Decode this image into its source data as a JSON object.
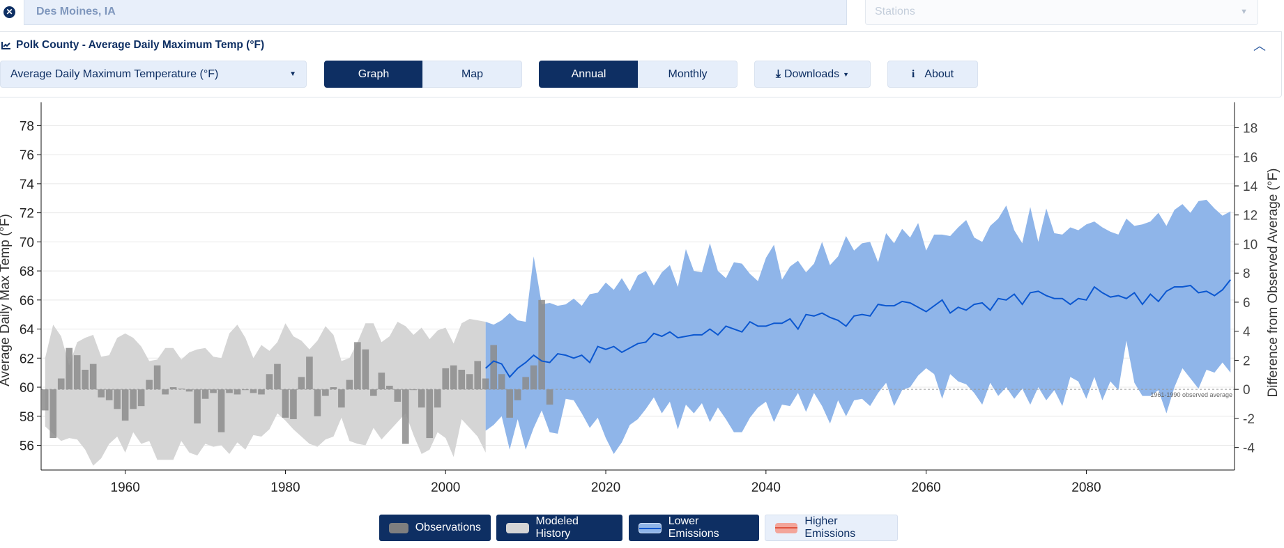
{
  "location": {
    "value": "Des Moines, IA",
    "clear_icon": "times-circle-icon"
  },
  "stations": {
    "placeholder": "Stations"
  },
  "panel": {
    "title": "Polk County - Average Daily Maximum Temp (°F)",
    "icon": "line-chart-icon"
  },
  "controls": {
    "variable": "Average Daily Maximum Temperature (°F)",
    "graph": "Graph",
    "map": "Map",
    "annual": "Annual",
    "monthly": "Monthly",
    "downloads": "Downloads",
    "about": "About",
    "active_view": "Graph",
    "active_period": "Annual"
  },
  "legend": {
    "observations": "Observations",
    "modeled_history": "Modeled History",
    "lower_emissions": "Lower Emissions",
    "higher_emissions": "Higher Emissions"
  },
  "colors": {
    "navy": "#0e2f63",
    "observations": "#8c8c8c",
    "modeled_history": "#d5d5d5",
    "lower_emissions": "#8fb5e9",
    "median_line": "#0b57d0",
    "higher_emissions": "#f3a59a"
  },
  "chart_data": {
    "type": "bar+area+line",
    "ylabel": "Average Daily Max Temp (°F)",
    "y2label": "Difference from Observed Average (°F)",
    "xlim": [
      1949.5,
      2098.5
    ],
    "ylim": [
      54.3,
      79.6
    ],
    "xticks": [
      1960,
      1980,
      2000,
      2020,
      2040,
      2060,
      2080
    ],
    "yticks": [
      56,
      58,
      60,
      62,
      64,
      66,
      68,
      70,
      72,
      74,
      76,
      78
    ],
    "y2ticks": [
      -4,
      -2,
      0,
      2,
      4,
      6,
      8,
      10,
      12,
      14,
      16,
      18
    ],
    "grid": true,
    "reference": {
      "value": 59.85,
      "label": "1961-1990 observed average"
    },
    "observations": {
      "start_year": 1950,
      "values": [
        58.4,
        56.5,
        60.6,
        62.7,
        62.2,
        61.2,
        61.6,
        59.3,
        59.1,
        58.5,
        57.7,
        58.5,
        58.7,
        60.5,
        61.5,
        59.5,
        60.0,
        59.9,
        59.7,
        57.5,
        59.2,
        59.6,
        56.9,
        59.6,
        59.5,
        59.8,
        59.6,
        59.5,
        60.9,
        61.6,
        57.9,
        57.8,
        60.7,
        62.1,
        58.0,
        59.4,
        60.0,
        58.6,
        60.5,
        63.1,
        62.6,
        59.4,
        61.0,
        60.1,
        59.0,
        56.1,
        59.8,
        58.6,
        56.5,
        58.6,
        61.3,
        61.5,
        61.2,
        60.9,
        61.8,
        60.6,
        62.9,
        60.9,
        57.9,
        59.1,
        60.7,
        61.5,
        66.0,
        58.8
      ]
    },
    "modeled_history": {
      "start_year": 1950,
      "upper": [
        62.0,
        64.3,
        63.5,
        61.5,
        63.1,
        63.4,
        63.6,
        62.1,
        62.2,
        63.4,
        63.7,
        63.4,
        62.8,
        61.8,
        61.9,
        62.7,
        62.7,
        61.9,
        62.4,
        62.6,
        62.7,
        62.1,
        62.0,
        63.7,
        64.3,
        63.4,
        62.0,
        62.9,
        62.5,
        63.1,
        64.4,
        63.5,
        63.2,
        62.6,
        63.2,
        64.2,
        63.6,
        61.8,
        62.0,
        63.1,
        64.4,
        64.4,
        63.1,
        63.5,
        64.5,
        64.2,
        63.6,
        64.1,
        63.3,
        63.9,
        64.1,
        63.0,
        64.4,
        64.7,
        64.6,
        64.5
      ],
      "lower": [
        57.3,
        56.8,
        56.3,
        56.5,
        56.4,
        55.7,
        54.6,
        55.1,
        56.1,
        56.6,
        55.5,
        56.9,
        56.1,
        56.3,
        55.0,
        55.0,
        55.0,
        56.3,
        55.5,
        55.3,
        56.1,
        55.9,
        56.0,
        55.4,
        56.2,
        55.7,
        56.7,
        56.6,
        57.1,
        58.2,
        57.7,
        57.1,
        56.6,
        56.1,
        55.9,
        56.4,
        56.6,
        57.9,
        56.3,
        56.1,
        56.0,
        57.2,
        56.4,
        57.0,
        57.6,
        58.2,
        56.7,
        55.4,
        55.7,
        56.9,
        56.5,
        55.2,
        57.8,
        57.2,
        56.6,
        55.5
      ]
    },
    "lower_emissions": {
      "start_year": 2005,
      "upper": [
        64.5,
        64.3,
        64.6,
        65.1,
        64.6,
        64.5,
        69.0,
        65.7,
        65.8,
        65.6,
        65.7,
        66.1,
        65.6,
        66.4,
        66.5,
        67.2,
        66.7,
        67.5,
        66.6,
        67.7,
        68.0,
        67.0,
        67.9,
        68.4,
        66.9,
        69.5,
        68.0,
        67.9,
        69.9,
        68.0,
        67.5,
        68.6,
        68.5,
        67.8,
        67.3,
        68.9,
        69.8,
        67.4,
        68.3,
        68.7,
        67.9,
        68.5,
        70.0,
        68.4,
        69.0,
        70.4,
        69.4,
        69.9,
        70.0,
        68.6,
        70.6,
        69.9,
        70.9,
        70.3,
        71.3,
        69.4,
        70.5,
        70.5,
        70.4,
        71.0,
        71.5,
        70.3,
        70.0,
        71.1,
        71.6,
        72.5,
        70.8,
        69.9,
        72.4,
        70.0,
        72.3,
        70.6,
        70.5,
        71.0,
        70.8,
        71.2,
        71.4,
        71.0,
        70.7,
        70.5,
        71.6,
        71.1,
        71.2,
        71.4,
        72.0,
        71.1,
        72.2,
        72.6,
        72.0,
        72.8,
        72.9,
        72.3,
        71.8,
        72.1
      ],
      "median": [
        61.3,
        61.8,
        61.6,
        60.7,
        61.3,
        61.7,
        62.2,
        61.8,
        61.7,
        62.3,
        62.2,
        62.0,
        62.2,
        61.7,
        62.8,
        62.6,
        62.8,
        62.4,
        62.7,
        63.0,
        63.1,
        63.7,
        63.5,
        63.8,
        63.4,
        63.5,
        63.6,
        63.6,
        64.0,
        63.6,
        64.2,
        64.0,
        63.8,
        64.5,
        64.2,
        64.2,
        64.4,
        64.4,
        64.7,
        64.0,
        65.0,
        64.9,
        65.1,
        64.8,
        64.6,
        64.2,
        64.9,
        65.0,
        64.9,
        65.7,
        65.6,
        65.6,
        65.9,
        65.8,
        65.5,
        65.2,
        65.6,
        66.0,
        65.1,
        65.5,
        65.3,
        65.7,
        65.8,
        65.3,
        66.1,
        66.0,
        66.4,
        65.7,
        66.5,
        66.6,
        66.3,
        66.1,
        66.1,
        65.7,
        66.1,
        66.0,
        66.9,
        66.5,
        66.2,
        66.3,
        66.1,
        66.5,
        65.7,
        66.4,
        65.9,
        66.6,
        66.9,
        66.9,
        67.0,
        66.5,
        66.6,
        66.3,
        66.7,
        67.4
      ],
      "lower": [
        57.0,
        57.4,
        58.0,
        55.7,
        57.8,
        55.7,
        57.2,
        58.4,
        56.9,
        56.8,
        59.2,
        59.1,
        58.2,
        57.2,
        57.9,
        56.5,
        55.4,
        56.2,
        57.4,
        57.8,
        58.5,
        59.3,
        58.2,
        59.0,
        57.1,
        58.8,
        58.2,
        58.9,
        57.6,
        58.6,
        57.8,
        56.9,
        56.9,
        57.9,
        58.6,
        59.0,
        57.6,
        58.8,
        58.7,
        59.6,
        58.3,
        59.6,
        58.7,
        57.5,
        59.1,
        58.0,
        59.1,
        59.2,
        58.7,
        59.6,
        60.3,
        58.7,
        59.8,
        60.0,
        60.8,
        61.3,
        60.9,
        59.2,
        60.9,
        60.4,
        60.2,
        59.6,
        58.8,
        60.3,
        59.4,
        60.0,
        59.2,
        59.9,
        58.8,
        60.0,
        59.1,
        59.8,
        58.7,
        60.7,
        60.4,
        59.2,
        60.7,
        59.1,
        60.4,
        59.8,
        63.2,
        60.3,
        59.4,
        59.4,
        59.8,
        58.2,
        60.0,
        61.3,
        60.6,
        59.9,
        61.2,
        61.0,
        61.7,
        61.0
      ]
    }
  }
}
